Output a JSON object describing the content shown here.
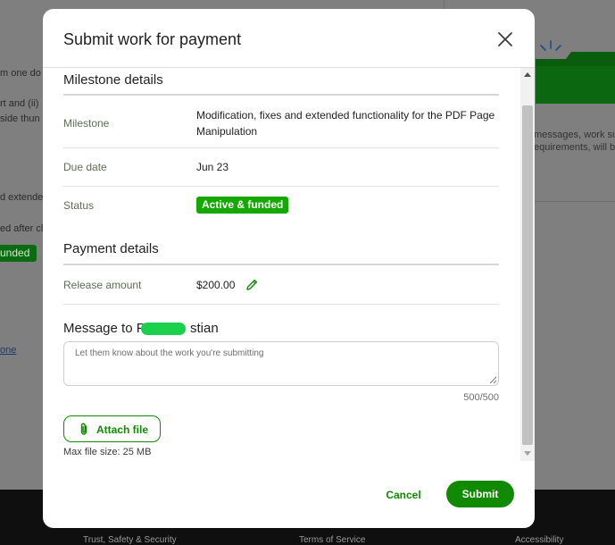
{
  "background": {
    "fragments": [
      "m one do",
      "rt and (ii)",
      "side thun",
      "d extende",
      "ed after cl"
    ],
    "status_badge": "unded",
    "link": "one",
    "right_panel": [
      "messages, work su",
      "equirements, will be"
    ],
    "footer_links": [
      "Trust, Safety & Security",
      "Terms of Service",
      "Accessibility"
    ]
  },
  "modal": {
    "title": "Submit work for payment",
    "milestone_section": {
      "title": "Milestone details",
      "rows": [
        {
          "label": "Milestone",
          "value": "Modification, fixes and extended functionality for the PDF Page Manipulation"
        },
        {
          "label": "Due date",
          "value": "Jun 23"
        },
        {
          "label": "Status",
          "value": "Active & funded"
        }
      ]
    },
    "payment_section": {
      "title": "Payment details",
      "release_label": "Release amount",
      "release_amount": "$200.00"
    },
    "message": {
      "title_prefix": "Message to P",
      "title_suffix": "stian",
      "placeholder": "Let them know about the work you're submitting",
      "counter": "500/500"
    },
    "attach": {
      "label": "Attach file",
      "max_size": "Max file size: 25 MB"
    },
    "actions": {
      "cancel": "Cancel",
      "submit": "Submit"
    }
  },
  "colors": {
    "brand_green": "#108a00",
    "status_green": "#14a800",
    "overlay": "#7f7f7f"
  },
  "icons": [
    "close-icon",
    "pencil-icon",
    "paperclip-icon",
    "folder-icon"
  ]
}
